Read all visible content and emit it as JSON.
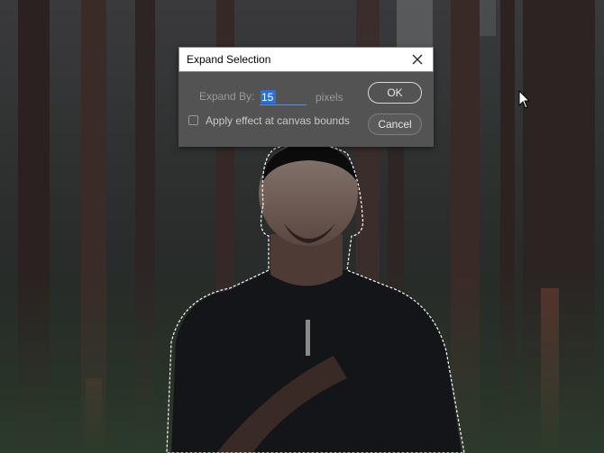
{
  "dialog": {
    "title": "Expand Selection",
    "expand_label": "Expand By:",
    "expand_value": "15",
    "unit": "pixels",
    "checkbox_label": "Apply effect at canvas bounds",
    "checkbox_checked": false,
    "ok_label": "OK",
    "cancel_label": "Cancel"
  },
  "icons": {
    "close": "close-icon",
    "cursor": "mouse-cursor-icon",
    "checkbox": "checkbox-icon"
  },
  "colors": {
    "dialog_bg": "#535353",
    "title_bg": "#ffffff",
    "selection_highlight": "#2f6fd0",
    "field_underline": "#6d8bb8"
  }
}
